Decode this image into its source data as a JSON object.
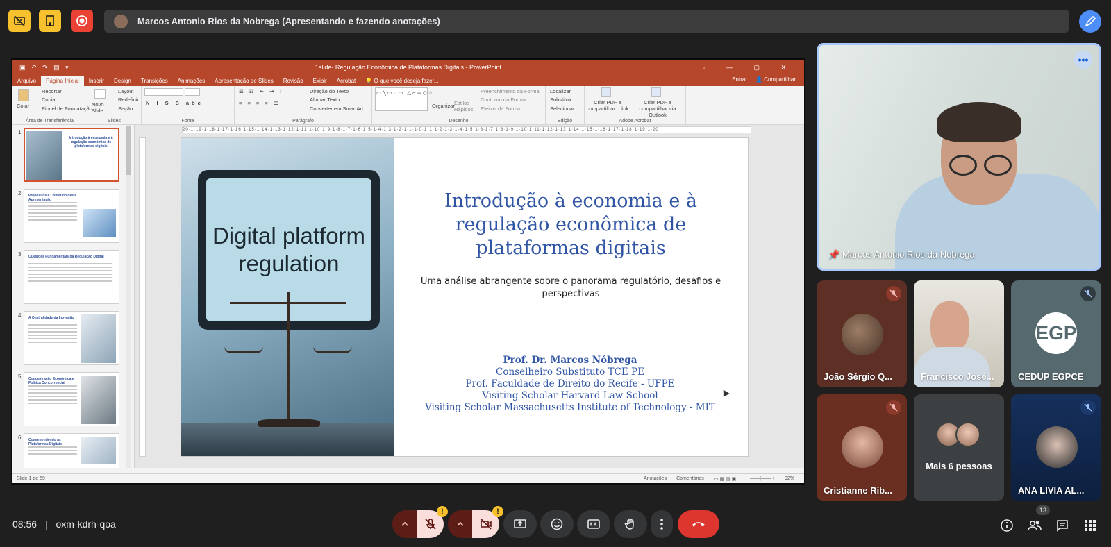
{
  "meeting": {
    "presenter_banner": "Marcos Antonio Rios da Nobrega (Apresentando e fazendo anotações)",
    "time": "08:56",
    "code": "oxm-kdrh-qoa",
    "participant_count": "13"
  },
  "colors": {
    "accent_yellow": "#f6c12d",
    "record_red": "#ea4335",
    "pen_blue": "#4c8df6",
    "hangup_red": "#dc362e",
    "ppt_red": "#b7472a"
  },
  "top_icons": [
    "no-captions-icon",
    "building-icon",
    "record-icon",
    "annotate-pen-icon"
  ],
  "ppt": {
    "window_title": "1slide- Regulação Econômica de Plataformas Digitais - PowerPoint",
    "tabs": [
      "Arquivo",
      "Página Inicial",
      "Inserir",
      "Design",
      "Transições",
      "Animações",
      "Apresentação de Slides",
      "Revisão",
      "Exibir",
      "Acrobat",
      "O que você deseja fazer..."
    ],
    "tab_right": [
      "Entrar",
      "Compartilhar"
    ],
    "ribbon": {
      "clipboard": {
        "paste": "Colar",
        "cut": "Recortar",
        "copy": "Copiar",
        "format_painter": "Pincel de Formatação",
        "group": "Área de Transferência"
      },
      "slides": {
        "new_slide": "Novo Slide",
        "layout": "Layout",
        "reset": "Redefinir",
        "section": "Seção",
        "group": "Slides"
      },
      "font": {
        "group": "Fonte"
      },
      "paragraph": {
        "text_direction": "Direção do Texto",
        "align_text": "Alinhar Texto",
        "smartart": "Converter em SmartArt",
        "group": "Parágrafo"
      },
      "drawing": {
        "arrange": "Organizar",
        "quick_styles": "Estilos Rápidos",
        "fill": "Preenchimento da Forma",
        "outline": "Contorno da Forma",
        "effects": "Efeitos de Forma",
        "group": "Desenho"
      },
      "editing": {
        "find": "Localizar",
        "replace": "Substituir",
        "select": "Selecionar",
        "group": "Edição"
      },
      "acrobat": {
        "create_pdf": "Criar PDF e compartilhar o link",
        "create_pdf_outlook": "Criar PDF e compartilhar via Outlook",
        "group": "Adobe Acrobat"
      }
    },
    "ruler_h": "20·1·19·1·18·1·17·1·16·1·15·1·14·1·13·1·12·1·11·1·10·1·9·1·8·1·7·1·6·1·5·1·4·1·3·1·2·1·1·1·0·1·1·1·2·1·3·1·4·1·5·1·6·1·7·1·8·1·9·1·10·1·11·1·12·1·13·1·14·1·15·1·16·1·17·1·18·1·19·1·20",
    "thumbnails": [
      {
        "num": "1",
        "title": "Introdução à economia e à regulação econômica de plataformas digitais"
      },
      {
        "num": "2",
        "title": "Propósitos e Conteúdo desta Apresentação"
      },
      {
        "num": "3",
        "title": "Questões Fundamentais da Regulação Digital"
      },
      {
        "num": "4",
        "title": "A Centralidade da Inovação"
      },
      {
        "num": "5",
        "title": "Concentração Econômica e Política Concorrencial"
      },
      {
        "num": "6",
        "title": "Compreendendo as Plataformas Digitais"
      }
    ],
    "slide": {
      "image_text": "Digital platform regulation",
      "title": "Introdução à economia e à regulação econômica de plataformas digitais",
      "subtitle": "Uma análise abrangente sobre o panorama regulatório, desafios e perspectivas",
      "author": "Prof. Dr. Marcos Nóbrega",
      "credits": [
        "Conselheiro Substituto TCE PE",
        "Prof. Faculdade de Direito do Recife - UFPE",
        "Visiting Scholar Harvard Law School",
        "Visiting Scholar Massachusetts Institute of Technology - MIT"
      ]
    },
    "status": {
      "slide_of": "Slide 1 de 59",
      "notes": "Anotações",
      "comments": "Comentários",
      "zoom": "92%"
    }
  },
  "participants": {
    "main": {
      "name": "Marcos Antonio Rios da Nobrega"
    },
    "tiles": [
      {
        "name": "João Sérgio Q...",
        "muted": true
      },
      {
        "name": "Francisco José...",
        "muted": false
      },
      {
        "name": "CEDUP EGPCE",
        "muted": true,
        "logo": "EGP"
      },
      {
        "name": "Cristianne Rib...",
        "muted": true
      },
      {
        "name": "Mais 6 pessoas",
        "muted": false
      },
      {
        "name": "ANA LIVIA AL...",
        "muted": true
      }
    ]
  }
}
